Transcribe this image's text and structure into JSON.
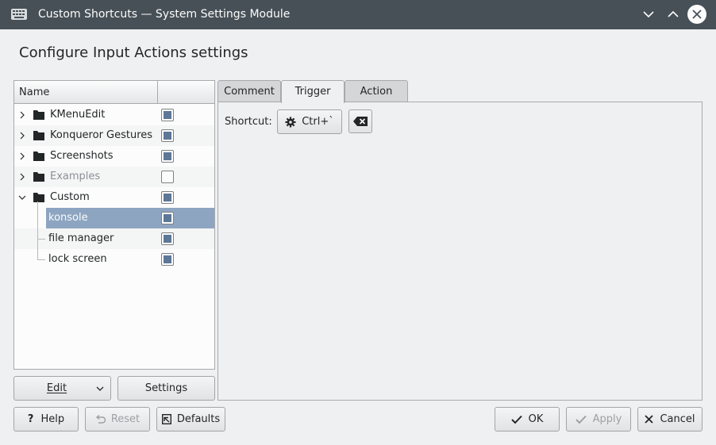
{
  "window": {
    "title": "Custom Shortcuts — System Settings Module",
    "app_icon": "keyboard-icon",
    "buttons": [
      "minimize-icon",
      "maximize-icon",
      "close-icon"
    ]
  },
  "heading": "Configure Input Actions settings",
  "tree": {
    "column_header": "Name",
    "items": [
      {
        "label": "KMenuEdit",
        "expandable": true,
        "expanded": false,
        "enabled": true,
        "checked": true
      },
      {
        "label": "Konqueror Gestures",
        "expandable": true,
        "expanded": false,
        "enabled": true,
        "checked": true
      },
      {
        "label": "Screenshots",
        "expandable": true,
        "expanded": false,
        "enabled": true,
        "checked": true
      },
      {
        "label": "Examples",
        "expandable": true,
        "expanded": false,
        "enabled": false,
        "checked": false
      },
      {
        "label": "Custom",
        "expandable": true,
        "expanded": true,
        "enabled": true,
        "checked": true
      },
      {
        "label": "konsole",
        "child": true,
        "selected": true,
        "checked": true
      },
      {
        "label": "file manager",
        "child": true,
        "checked": true
      },
      {
        "label": "lock screen",
        "child": true,
        "checked": true
      }
    ]
  },
  "left_buttons": {
    "edit": "Edit",
    "settings": "Settings"
  },
  "tabs": [
    {
      "label": "Comment",
      "active": false
    },
    {
      "label": "Trigger",
      "active": true
    },
    {
      "label": "Action",
      "active": false
    }
  ],
  "trigger": {
    "shortcut_label": "Shortcut:",
    "shortcut_value": "Ctrl+`",
    "shortcut_icon": "gear-icon",
    "clear_icon": "backspace-icon"
  },
  "bottom_buttons": {
    "help": "Help",
    "reset": "Reset",
    "defaults": "Defaults",
    "ok": "OK",
    "apply": "Apply",
    "cancel": "Cancel"
  },
  "colors": {
    "titlebar": "#475057",
    "selection": "#8da5c1",
    "checkbox_fill": "#5d7797"
  }
}
